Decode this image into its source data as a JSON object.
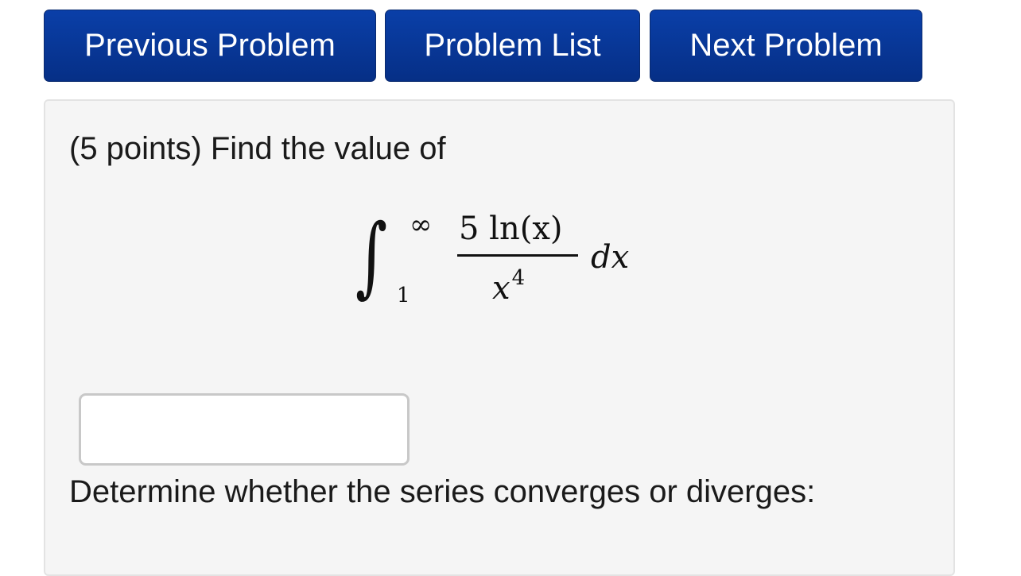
{
  "nav": {
    "previous_label": "Previous Problem",
    "list_label": "Problem List",
    "next_label": "Next Problem",
    "button_color": "#062f86"
  },
  "problem": {
    "prompt": "(5 points) Find the value of",
    "integral": {
      "upper_limit": "∞",
      "lower_limit": "1",
      "numerator": "5 ln(x)",
      "denominator_base": "x",
      "denominator_exponent": "4",
      "differential": "dx"
    },
    "answer": {
      "value": "",
      "placeholder": ""
    },
    "series_question": "Determine whether the series converges or diverges:"
  }
}
